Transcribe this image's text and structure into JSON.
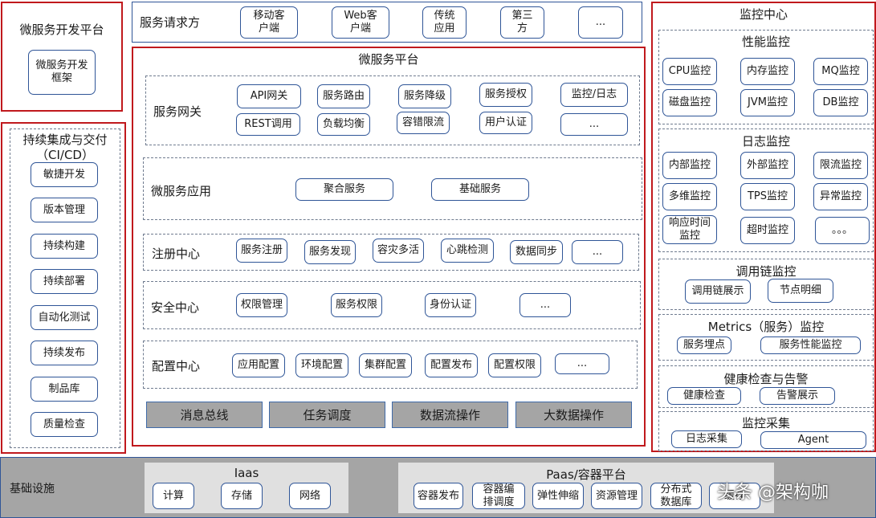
{
  "left_top": {
    "title": "微服务开发平台",
    "node": "微服务开发\n框架"
  },
  "cicd": {
    "title": "持续集成与交付\n（CI/CD）",
    "items": [
      "敏捷开发",
      "版本管理",
      "持续构建",
      "持续部署",
      "自动化测试",
      "持续发布",
      "制品库",
      "质量检查"
    ]
  },
  "requesters": {
    "label": "服务请求方",
    "items": [
      "移动客\n户端",
      "Web客\n户端",
      "传统\n应用",
      "第三\n方",
      "..."
    ]
  },
  "platform": {
    "title": "微服务平台",
    "gateway": {
      "label": "服务网关",
      "row1": [
        "API网关",
        "服务路由",
        "服务降级",
        "服务授权",
        "监控/日志"
      ],
      "row2": [
        "REST调用",
        "负载均衡",
        "容错限流",
        "用户认证",
        "..."
      ]
    },
    "apps": {
      "label": "微服务应用",
      "items": [
        "聚合服务",
        "基础服务"
      ]
    },
    "registry": {
      "label": "注册中心",
      "items": [
        "服务注册",
        "服务发现",
        "容灾多活",
        "心跳检测",
        "数据同步",
        "..."
      ]
    },
    "security": {
      "label": "安全中心",
      "items": [
        "权限管理",
        "服务权限",
        "身份认证",
        "..."
      ]
    },
    "config": {
      "label": "配置中心",
      "items": [
        "应用配置",
        "环境配置",
        "集群配置",
        "配置发布",
        "配置权限",
        "..."
      ]
    },
    "bars": [
      "消息总线",
      "任务调度",
      "数据流操作",
      "大数据操作"
    ]
  },
  "monitor": {
    "title": "监控中心",
    "perf": {
      "title": "性能监控",
      "items": [
        "CPU监控",
        "内存监控",
        "MQ监控",
        "磁盘监控",
        "JVM监控",
        "DB监控"
      ]
    },
    "log": {
      "title": "日志监控",
      "items": [
        "内部监控",
        "外部监控",
        "限流监控",
        "多维监控",
        "TPS监控",
        "异常监控",
        "响应时间\n监控",
        "超时监控",
        "。。。"
      ]
    },
    "trace": {
      "title": "调用链监控",
      "items": [
        "调用链展示",
        "节点明细"
      ]
    },
    "metrics": {
      "title": "Metrics（服务）监控",
      "items": [
        "服务埋点",
        "服务性能监控"
      ]
    },
    "health": {
      "title": "健康检查与告警",
      "items": [
        "健康检查",
        "告警展示"
      ]
    },
    "collect": {
      "title": "监控采集",
      "items": [
        "日志采集",
        "Agent"
      ]
    }
  },
  "infra": {
    "label": "基础设施",
    "iaas": {
      "title": "Iaas",
      "items": [
        "计算",
        "存储",
        "网络"
      ]
    },
    "paas": {
      "title": "Paas/容器平台",
      "items": [
        "容器发布",
        "容器编\n排调度",
        "弹性伸缩",
        "资源管理",
        "分布式\n数据库",
        "缓存"
      ]
    }
  },
  "watermark": "头条 @架构咖"
}
